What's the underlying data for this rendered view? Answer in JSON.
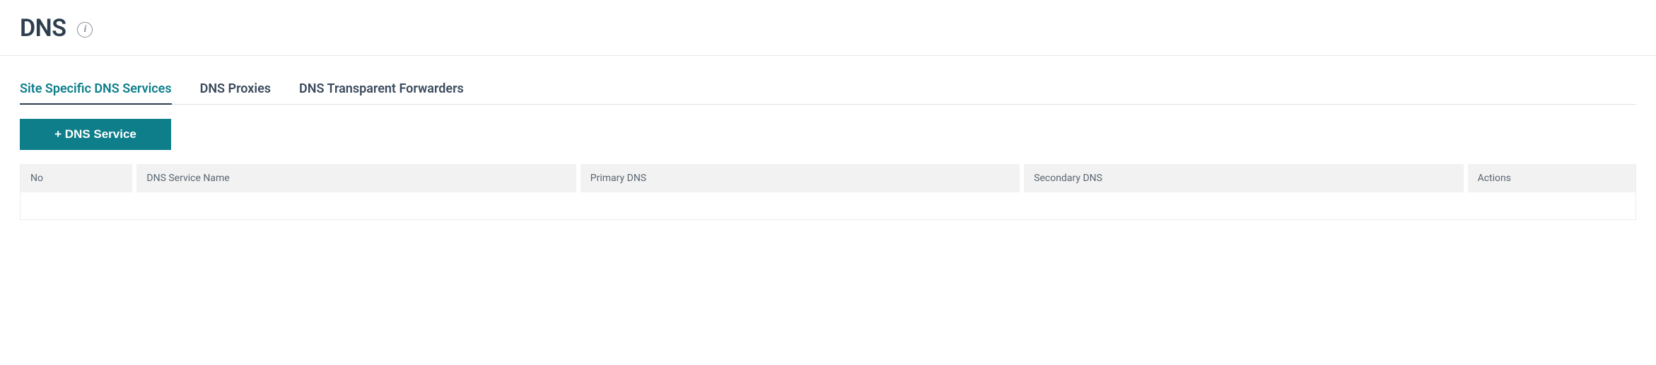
{
  "header": {
    "title": "DNS"
  },
  "tabs": [
    {
      "label": "Site Specific DNS Services",
      "active": true
    },
    {
      "label": "DNS Proxies",
      "active": false
    },
    {
      "label": "DNS Transparent Forwarders",
      "active": false
    }
  ],
  "toolbar": {
    "add_button_label": "+ DNS Service"
  },
  "table": {
    "columns": {
      "no": "No",
      "name": "DNS Service Name",
      "primary": "Primary DNS",
      "secondary": "Secondary DNS",
      "actions": "Actions"
    },
    "rows": []
  },
  "colors": {
    "accent": "#0d7e8a",
    "text": "#2c3e50",
    "muted": "#5a6572",
    "header_bg": "#f2f2f2"
  }
}
